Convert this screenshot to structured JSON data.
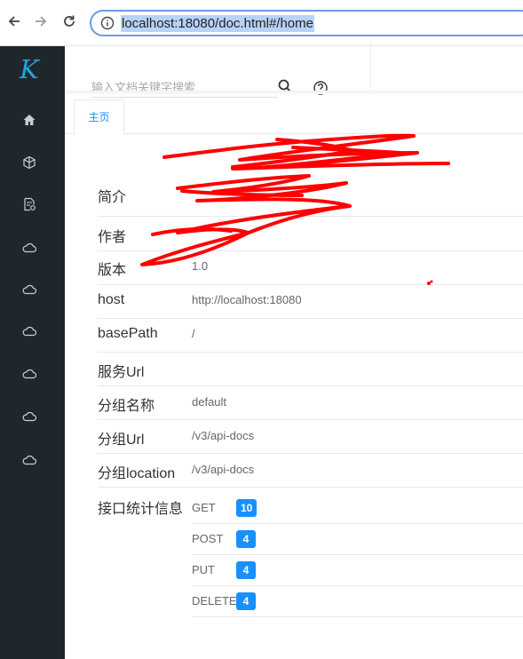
{
  "browser": {
    "url": "localhost:18080/doc.html#/home",
    "back_icon": "arrow-left-icon",
    "forward_icon": "arrow-right-icon",
    "reload_icon": "reload-icon",
    "info_icon": "info-icon"
  },
  "sidebar": {
    "logo": "K",
    "items": [
      {
        "icon": "home-icon"
      },
      {
        "icon": "cube-icon"
      },
      {
        "icon": "doc-settings-icon"
      },
      {
        "icon": "cloud-icon"
      },
      {
        "icon": "cloud-icon"
      },
      {
        "icon": "cloud-icon"
      },
      {
        "icon": "cloud-icon"
      },
      {
        "icon": "cloud-icon"
      },
      {
        "icon": "cloud-icon"
      }
    ]
  },
  "header": {
    "search_placeholder": "输入文档关键字搜索"
  },
  "tabs": [
    {
      "label": "主页",
      "active": true
    }
  ],
  "info": {
    "intro_label": "简介",
    "author_label": "作者",
    "version_label": "版本",
    "version_value": "1.0",
    "host_label": "host",
    "host_value": "http://localhost:18080",
    "basepath_label": "basePath",
    "basepath_value": "/",
    "service_url_label": "服务Url",
    "group_name_label": "分组名称",
    "group_name_value": "default",
    "group_url_label": "分组Url",
    "group_url_value": "/v3/api-docs",
    "group_location_label": "分组location",
    "group_location_value": "/v3/api-docs",
    "stats_label": "接口统计信息"
  },
  "stats": [
    {
      "method": "GET",
      "count": "10"
    },
    {
      "method": "POST",
      "count": "4"
    },
    {
      "method": "PUT",
      "count": "4"
    },
    {
      "method": "DELETE",
      "count": "4"
    }
  ],
  "colors": {
    "sidebar_bg": "#1e282c",
    "accent": "#1890ff",
    "scribble": "#ff0000"
  }
}
